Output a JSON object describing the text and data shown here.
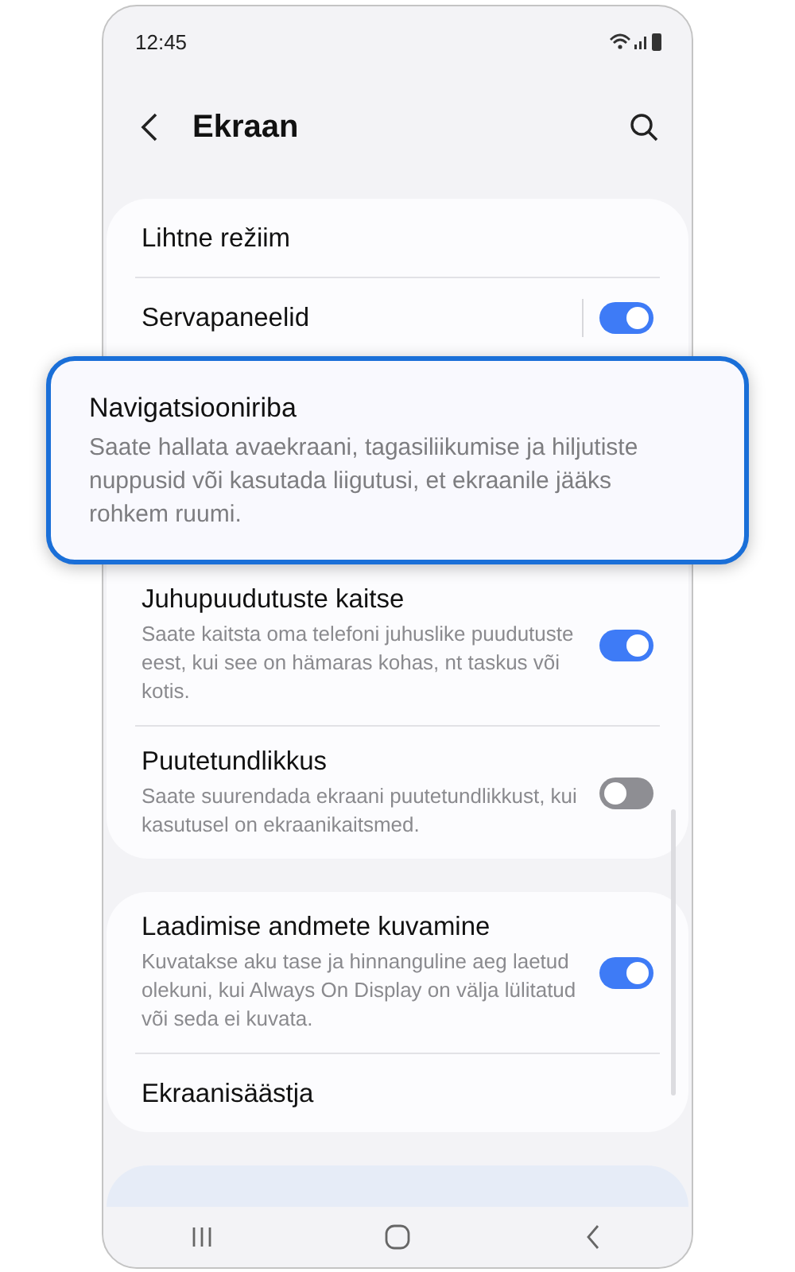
{
  "status_bar": {
    "time": "12:45"
  },
  "header": {
    "title": "Ekraan"
  },
  "groups": [
    {
      "items": [
        {
          "kind": "plain",
          "title": "Lihtne režiim"
        },
        {
          "kind": "switch",
          "title": "Servapaneelid",
          "on": true,
          "separator": true
        },
        {
          "kind": "highlight",
          "title": "Navigatsiooniriba",
          "summary": "Saate hallata avaekraani, tagasiliikumise ja hiljutiste nuppusid või kasutada liigutusi, et ekraanile jääks rohkem ruumi."
        },
        {
          "kind": "switch",
          "title": "Juhupuudutuste kaitse",
          "summary": "Saate kaitsta oma telefoni juhuslike puudutuste eest, kui see on hämaras kohas, nt taskus või kotis.",
          "on": true
        },
        {
          "kind": "switch",
          "title": "Puutetundlikkus",
          "summary": "Saate suurendada ekraani puutetundlikkust, kui kasutusel on ekraanikaitsmed.",
          "on": false
        }
      ]
    },
    {
      "items": [
        {
          "kind": "switch",
          "title": "Laadimise andmete kuvamine",
          "summary": "Kuvatakse aku tase ja hinnanguline aeg laetud olekuni, kui Always On Display on välja lülitatud või seda ei kuvata.",
          "on": true
        },
        {
          "kind": "plain",
          "title": "Ekraanisäästja"
        }
      ]
    }
  ],
  "suggestion_card": {
    "shown": true
  }
}
